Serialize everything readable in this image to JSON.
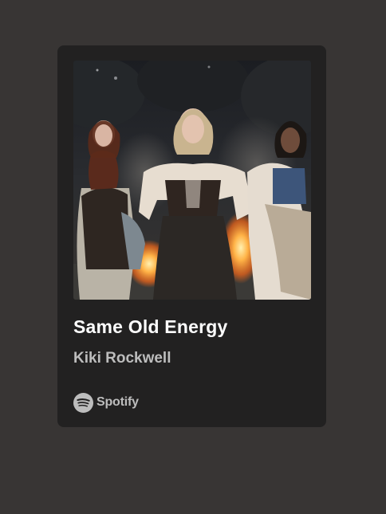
{
  "embed": {
    "track_title": "Same Old Energy",
    "artist_name": "Kiki Rockwell",
    "brand_name": "Spotify",
    "cover_art_icon": "album-cover-image",
    "brand_icon": "spotify-logo-icon"
  },
  "colors": {
    "page_background": "#383534",
    "card_background": "#222121",
    "title_text": "#ffffff",
    "secondary_text": "#bdbdbd"
  }
}
